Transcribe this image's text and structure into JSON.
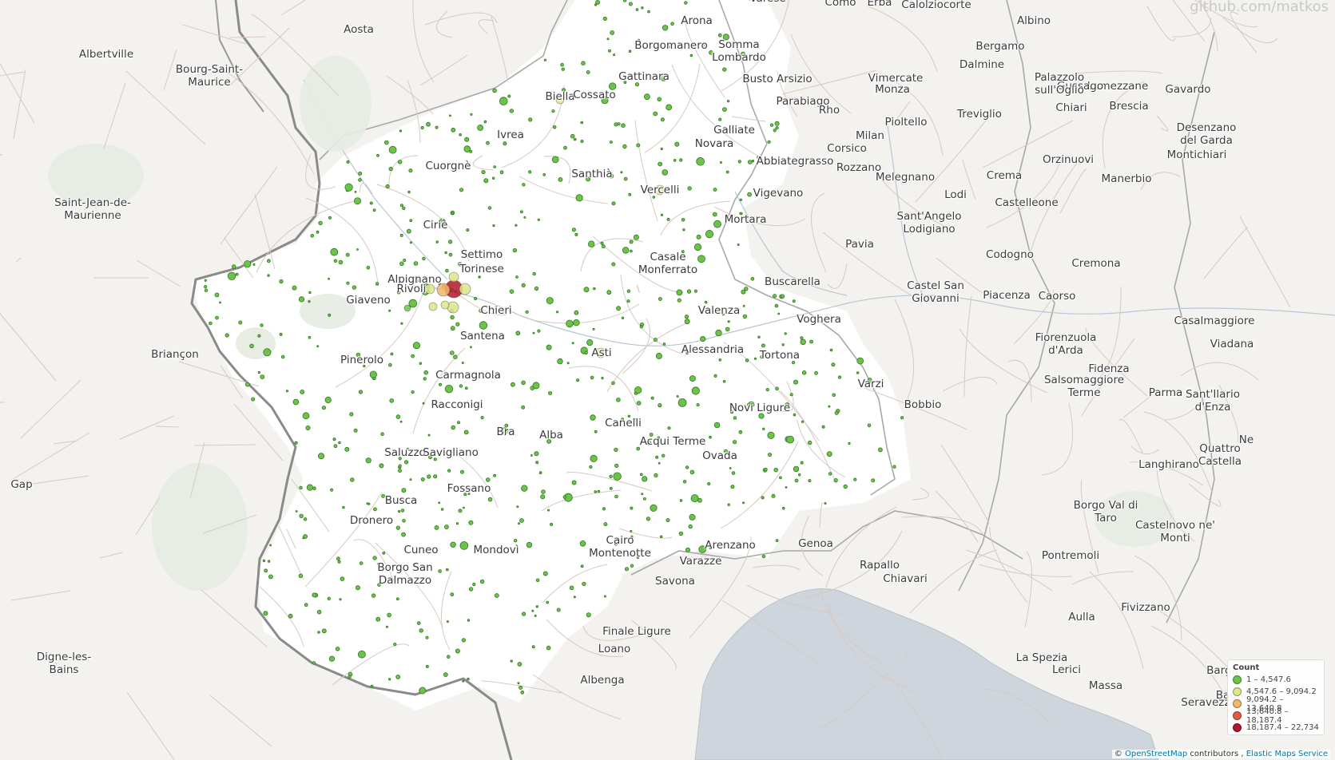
{
  "map": {
    "watermark": "github.com/matkos",
    "legend": {
      "title": "Count",
      "items": [
        {
          "label": "1 – 4,547.6",
          "color": "#6cc24a"
        },
        {
          "label": "4,547.6 – 9,094.2",
          "color": "#dce68a"
        },
        {
          "label": "9,094.2 – 13,640.8",
          "color": "#f2b56b"
        },
        {
          "label": "13,640.8 – 18,187.4",
          "color": "#e25a44"
        },
        {
          "label": "18,187.4 – 22,734",
          "color": "#b0172e"
        }
      ]
    },
    "attribution": {
      "prefix": "©",
      "osm": "OpenStreetMap",
      "middle": "contributors ,",
      "ems": "Elastic Maps Service"
    },
    "places": [
      {
        "name": "Aosta"
      },
      {
        "name": "Albertville"
      },
      {
        "name": "Bourg-Saint-\nMaurice"
      },
      {
        "name": "Saint-Jean-de-\nMaurienne"
      },
      {
        "name": "Briançon"
      },
      {
        "name": "Gap"
      },
      {
        "name": "Digne-les-\nBains"
      },
      {
        "name": "Biella"
      },
      {
        "name": "Cossato"
      },
      {
        "name": "Ivrea"
      },
      {
        "name": "Cuorgnè"
      },
      {
        "name": "Ciriè"
      },
      {
        "name": "Santhià"
      },
      {
        "name": "Vercelli"
      },
      {
        "name": "Settimo"
      },
      {
        "name": "Torinese"
      },
      {
        "name": "Alpignano"
      },
      {
        "name": "Rivoli"
      },
      {
        "name": "Giaveno"
      },
      {
        "name": "Chieri"
      },
      {
        "name": "Santena"
      },
      {
        "name": "Pinerolo"
      },
      {
        "name": "Carmagnola"
      },
      {
        "name": "Racconigi"
      },
      {
        "name": "Bra"
      },
      {
        "name": "Alba"
      },
      {
        "name": "Canelli"
      },
      {
        "name": "Acqui Terme"
      },
      {
        "name": "Ovada"
      },
      {
        "name": "Saluzzo"
      },
      {
        "name": "Savigliano"
      },
      {
        "name": "Fossano"
      },
      {
        "name": "Busca"
      },
      {
        "name": "Dronero"
      },
      {
        "name": "Cuneo"
      },
      {
        "name": "Mondovì"
      },
      {
        "name": "Borgo San\nDalmazzo"
      },
      {
        "name": "Casale\nMonferrato"
      },
      {
        "name": "Valenza"
      },
      {
        "name": "Alessandria"
      },
      {
        "name": "Asti"
      },
      {
        "name": "Tortona"
      },
      {
        "name": "Novi Ligure"
      },
      {
        "name": "Voghera"
      },
      {
        "name": "Varzi"
      },
      {
        "name": "Bobbio"
      },
      {
        "name": "Mortara"
      },
      {
        "name": "Vigevano"
      },
      {
        "name": "Pavia"
      },
      {
        "name": "Buscarella"
      },
      {
        "name": "Novara"
      },
      {
        "name": "Galliate"
      },
      {
        "name": "Abbiategrasso"
      },
      {
        "name": "Gattinara"
      },
      {
        "name": "Borgomanero"
      },
      {
        "name": "Somma\nLombardo"
      },
      {
        "name": "Arona"
      },
      {
        "name": "Busto Arsizio"
      },
      {
        "name": "Parabiago"
      },
      {
        "name": "Rho"
      },
      {
        "name": "Milan"
      },
      {
        "name": "Corsico"
      },
      {
        "name": "Rozzano"
      },
      {
        "name": "Monza"
      },
      {
        "name": "Vimercate"
      },
      {
        "name": "Pioltello"
      },
      {
        "name": "Melegnano"
      },
      {
        "name": "Lodi"
      },
      {
        "name": "Crema"
      },
      {
        "name": "Treviglio"
      },
      {
        "name": "Bergamo"
      },
      {
        "name": "Dalmine"
      },
      {
        "name": "Albino"
      },
      {
        "name": "Calolziocorte"
      },
      {
        "name": "Como"
      },
      {
        "name": "Erba"
      },
      {
        "name": "Varese"
      },
      {
        "name": "Lumezzane"
      },
      {
        "name": "Gussago"
      },
      {
        "name": "Brescia"
      },
      {
        "name": "Gavardo"
      },
      {
        "name": "Palazzolo\nsull'Oglio"
      },
      {
        "name": "Chiari"
      },
      {
        "name": "Orzinuovi"
      },
      {
        "name": "Manerbio"
      },
      {
        "name": "Montichiari"
      },
      {
        "name": "Desenzano\ndel Garda"
      },
      {
        "name": "Castelleone"
      },
      {
        "name": "Sant'Angelo\nLodigiano"
      },
      {
        "name": "Codogno"
      },
      {
        "name": "Cremona"
      },
      {
        "name": "Castel San\nGiovanni"
      },
      {
        "name": "Piacenza"
      },
      {
        "name": "Caorso"
      },
      {
        "name": "Fiorenzuola\nd'Arda"
      },
      {
        "name": "Fidenza"
      },
      {
        "name": "Salsomaggiore\nTerme"
      },
      {
        "name": "Parma"
      },
      {
        "name": "Sant'Ilario\nd'Enza"
      },
      {
        "name": "Casalmaggiore"
      },
      {
        "name": "Viadana"
      },
      {
        "name": "Quattro\nCastella"
      },
      {
        "name": "Langhirano"
      },
      {
        "name": "Borgo Val di\nTaro"
      },
      {
        "name": "Castelnovo ne'\nMonti"
      },
      {
        "name": "Pontremoli"
      },
      {
        "name": "Aulla"
      },
      {
        "name": "Fivizzano"
      },
      {
        "name": "La Spezia"
      },
      {
        "name": "Lerici"
      },
      {
        "name": "Massa"
      },
      {
        "name": "Barga"
      },
      {
        "name": "Bagni"
      },
      {
        "name": "Seravezza"
      },
      {
        "name": "Rapallo"
      },
      {
        "name": "Chiavari"
      },
      {
        "name": "Genoa"
      },
      {
        "name": "Arenzano"
      },
      {
        "name": "Varazze"
      },
      {
        "name": "Savona"
      },
      {
        "name": "Cairo\nMontenotte"
      },
      {
        "name": "Finale Ligure"
      },
      {
        "name": "Loano"
      },
      {
        "name": "Albenga"
      },
      {
        "name": "Ne"
      }
    ]
  }
}
